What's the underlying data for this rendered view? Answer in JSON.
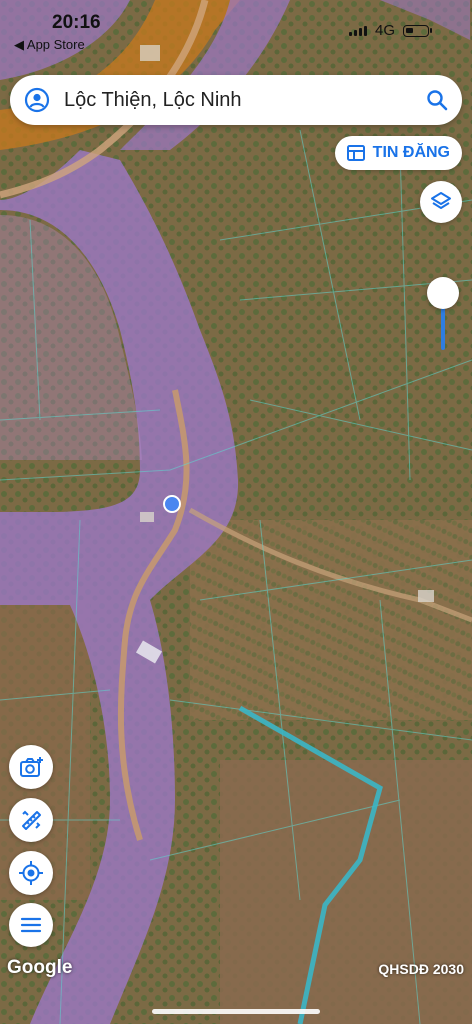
{
  "status_bar": {
    "time": "20:16",
    "back_label": "◀ App Store",
    "network": "4G"
  },
  "search": {
    "value": "Lộc Thiện, Lộc Ninh"
  },
  "actions": {
    "post_label": "TIN ĐĂNG"
  },
  "map": {
    "attribution": "Google",
    "overlay_label": "QHSDĐ 2030"
  },
  "colors": {
    "accent": "#1a73e8",
    "zone_purple": "#9c78c8",
    "zone_orange": "#c87a1e",
    "parcel_line": "#5fd6d0",
    "location_dot": "#4a86f0"
  },
  "icons": {
    "search_left": "account-icon",
    "search_right": "search-icon",
    "post": "newspaper-icon",
    "layers": "layers-icon",
    "fab_1": "camera-add-icon",
    "fab_2": "measure-ruler-icon",
    "fab_3": "my-location-icon",
    "fab_4": "menu-icon"
  }
}
